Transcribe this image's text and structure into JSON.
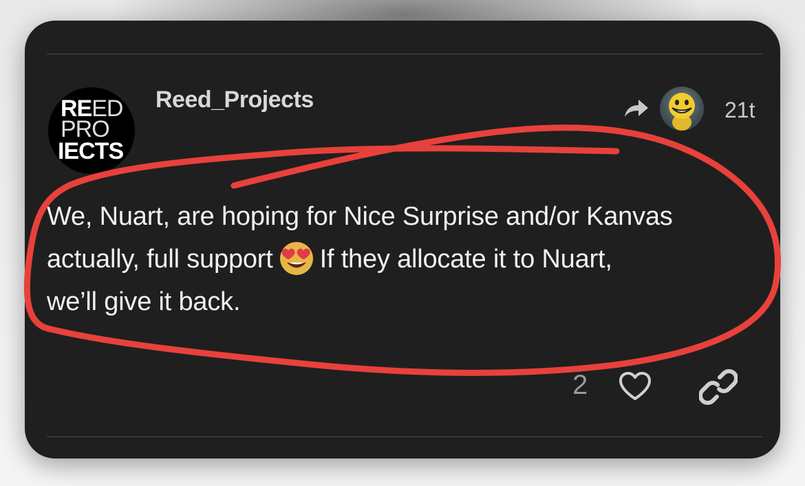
{
  "post": {
    "username": "Reed_Projects",
    "avatar_text": {
      "line1_bold": "RE",
      "line1_light": "ED",
      "line2": "PRO",
      "line3": "IECTS"
    },
    "timestamp": "21t",
    "body_lines": {
      "line1": "We, Nuart, are hoping for Nice Surprise and/or Kanvas",
      "line2_before": "actually, full support",
      "line2_after": "If they allocate it to Nuart,",
      "line3": "we’ll give it back."
    },
    "emoji": "heart-eyes-emoji",
    "like_count": "2"
  },
  "icons": {
    "reply": "reply-arrow-icon",
    "like": "heart-icon",
    "share": "link-icon"
  },
  "colors": {
    "card_background": "#1f1f1f",
    "annotation_red": "#e8413b",
    "text_primary": "#f1f1f1",
    "text_muted": "#9a9a9a"
  }
}
